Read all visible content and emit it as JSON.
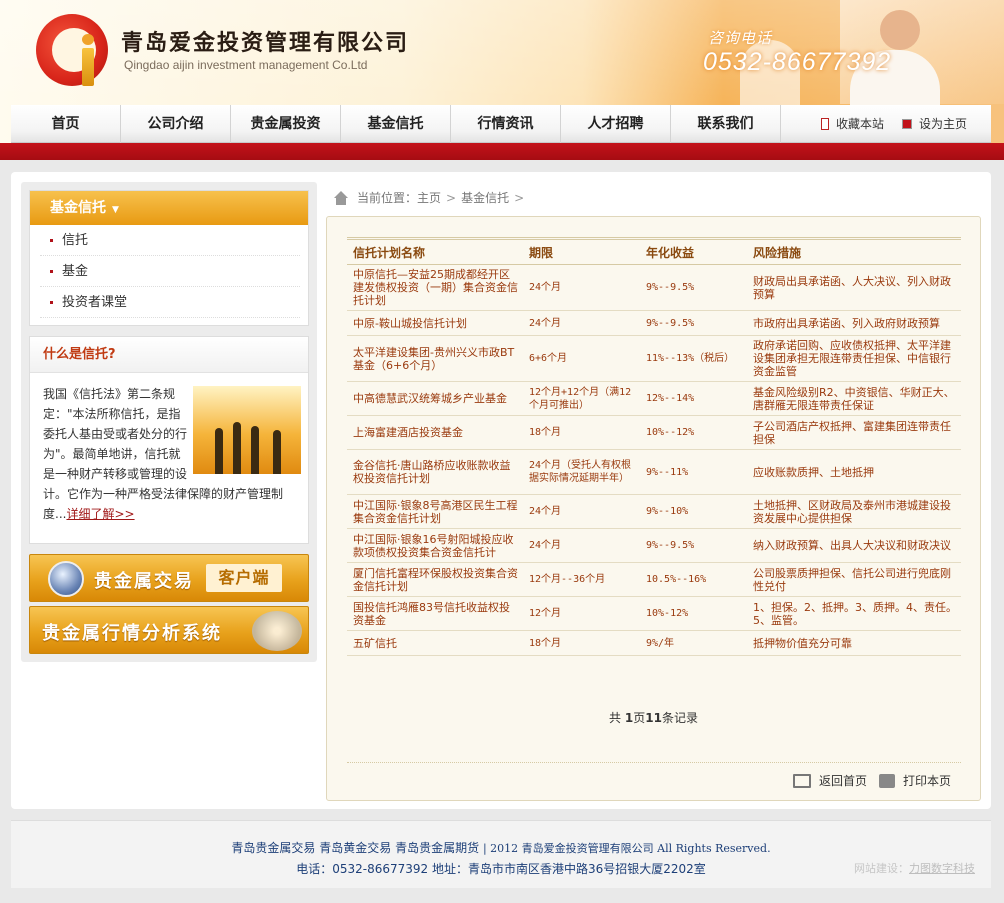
{
  "header": {
    "company_name": "青岛爱金投资管理有限公司",
    "company_en": "Qingdao aijin investment management Co.Ltd",
    "hotline_label": "咨询电话",
    "hotline_number": "0532-86677392"
  },
  "nav": {
    "items": [
      "首页",
      "公司介绍",
      "贵金属投资",
      "基金信托",
      "行情资讯",
      "人才招聘",
      "联系我们"
    ],
    "bookmark": "收藏本站",
    "set_home": "设为主页"
  },
  "sidebar": {
    "fund_title": "基金信托",
    "fund_links": [
      "信托",
      "基金",
      "投资者课堂"
    ],
    "what_title": "什么是信托?",
    "what_text": "我国《信托法》第二条规定：\"本法所称信托，是指委托人基由受或者处分的行为\"。最简单地讲，信托就是一种财产转移或管理的设计。它作为一种严格受法律保障的财产管理制度...",
    "what_more": "详细了解>>",
    "banner1_text": "贵金属交易",
    "banner1_badge": "客户端",
    "banner2_text": "贵金属行情分析系统"
  },
  "breadcrumb": {
    "label": "当前位置：",
    "home": "主页",
    "current": "基金信托",
    "sep": ">"
  },
  "table": {
    "headers": [
      "信托计划名称",
      "期限",
      "年化收益",
      "风险措施"
    ],
    "rows": [
      [
        "中原信托—安益25期成都经开区建发债权投资（一期）集合资金信托计划",
        "24个月",
        "9%--9.5%",
        "财政局出具承诺函、人大决议、列入财政预算"
      ],
      [
        "中原-鞍山城投信托计划",
        "24个月",
        "9%--9.5%",
        "市政府出具承诺函、列入政府财政预算"
      ],
      [
        "太平洋建设集团-贵州兴义市政BT基金（6+6个月）",
        "6+6个月",
        "11%--13%（税后）",
        "政府承诺回购、应收债权抵押、太平洋建设集团承担无限连带责任担保、中信银行资金监管"
      ],
      [
        "中高德慧武汉统筹城乡产业基金",
        "12个月+12个月（满12个月可推出）",
        "12%--14%",
        "基金风险级别R2、中资银信、华财正大、唐群雁无限连带责任保证"
      ],
      [
        "上海富建酒店投资基金",
        "18个月",
        "10%--12%",
        "子公司酒店产权抵押、富建集团连带责任担保"
      ],
      [
        "金谷信托·唐山路桥应收账款收益权投资信托计划",
        "24个月（受托人有权根据实际情况延期半年）",
        "9%--11%",
        "应收账款质押、土地抵押"
      ],
      [
        "中江国际·银象8号高港区民生工程集合资金信托计划",
        "24个月",
        "9%--10%",
        "土地抵押、区财政局及泰州市港城建设投资发展中心提供担保"
      ],
      [
        "中江国际·银象16号射阳城投应收款项债权投资集合资金信托计",
        "24个月",
        "9%--9.5%",
        "纳入财政预算、出具人大决议和财政决议"
      ],
      [
        "厦门信托富程环保股权投资集合资金信托计划",
        "12个月--36个月",
        "10.5%--16%",
        "公司股票质押担保、信托公司进行兜底刚性兑付"
      ],
      [
        "国投信托鸿雁83号信托收益权投资基金",
        "12个月",
        "10%-12%",
        "1、担保。2、抵押。3、质押。4、责任。5、监管。"
      ],
      [
        "五矿信托",
        "18个月",
        "9%/年",
        "抵押物价值充分可靠"
      ]
    ]
  },
  "pager": {
    "prefix": "共 ",
    "pages": "1",
    "mid": "页",
    "records": "11",
    "suffix": "条记录"
  },
  "actions": {
    "back_home": "返回首页",
    "print": "打印本页"
  },
  "footer": {
    "links": [
      "青岛贵金属交易",
      "青岛黄金交易",
      "青岛贵金属期货"
    ],
    "copyright": "| 2012 青岛爱金投资管理有限公司 All Rights Reserved.",
    "contact": "电话：0532-86677392 地址：青岛市市南区香港中路36号招银大厦2202室",
    "credit_label": "网站建设：",
    "credit_name": "力图数字科技"
  },
  "colors": {
    "brand_red": "#c4121a",
    "accent_orange": "#e89a12",
    "table_text": "#9a3a0e"
  }
}
